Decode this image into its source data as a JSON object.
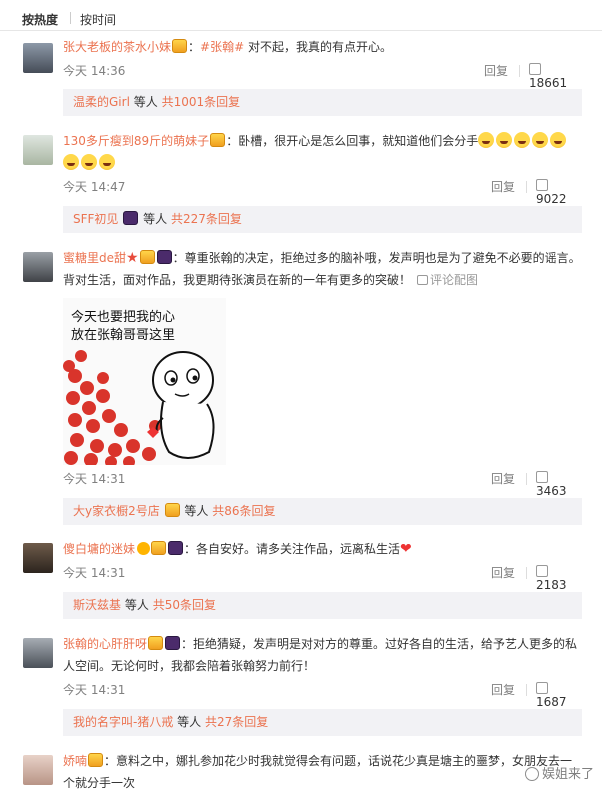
{
  "tabs": {
    "hot": "按热度",
    "time": "按时间"
  },
  "comments": [
    {
      "username": "张大老板的茶水小妹",
      "hashtag": "#张翰#",
      "text": "对不起，我真的有点开心。",
      "time": "今天 14:36",
      "reply_label": "回复",
      "likes": "18661",
      "subbar": {
        "user": "温柔的Girl",
        "mid": "等人",
        "total": "共1001条回复"
      }
    },
    {
      "username": "130多斤瘦到89斤的萌妹子",
      "text": "卧槽，很开心是怎么回事，就知道他们会分手",
      "time": "今天 14:47",
      "reply_label": "回复",
      "likes": "9022",
      "subbar": {
        "user": "SFF初见",
        "mid": "等人",
        "total": "共227条回复"
      }
    },
    {
      "username": "蜜糖里de甜",
      "text": "尊重张翰的决定，拒绝过多的脑补哦，发声明也是为了避免不必要的谣言。背对生活，面对作品，我更期待张演员在新的一年有更多的突破！",
      "report": "评论配图",
      "sticker_line1": "今天也要把我的心",
      "sticker_line2": "放在张翰哥哥这里",
      "time": "今天 14:31",
      "reply_label": "回复",
      "likes": "3463",
      "subbar": {
        "user": "大y家衣橱2号店",
        "mid": "等人",
        "total": "共86条回复"
      }
    },
    {
      "username": "傻白墉的迷妹",
      "text": "各自安好。请多关注作品，远离私生活",
      "time": "今天 14:31",
      "reply_label": "回复",
      "likes": "2183",
      "subbar": {
        "user": "斯沃兹基",
        "mid": "等人",
        "total": "共50条回复"
      }
    },
    {
      "username": "张翰的心肝肝呀",
      "text": "拒绝猜疑，发声明是对对方的尊重。过好各自的生活，给予艺人更多的私人空间。无论何时，我都会陪着张翰努力前行！",
      "time": "今天 14:31",
      "reply_label": "回复",
      "likes": "1687",
      "subbar": {
        "user": "我的名字叫-猪八戒",
        "mid": "等人",
        "total": "共27条回复"
      }
    },
    {
      "username": "娇喃",
      "text": "意料之中，娜扎参加花少时我就觉得会有问题，话说花少真是塘主的噩梦，女朋友去一个就分手一次"
    }
  ],
  "watermark": "娱姐来了",
  "colors": {
    "username": "#eb7350",
    "meta": "#808080",
    "subbar_bg": "#f2f2f5"
  }
}
